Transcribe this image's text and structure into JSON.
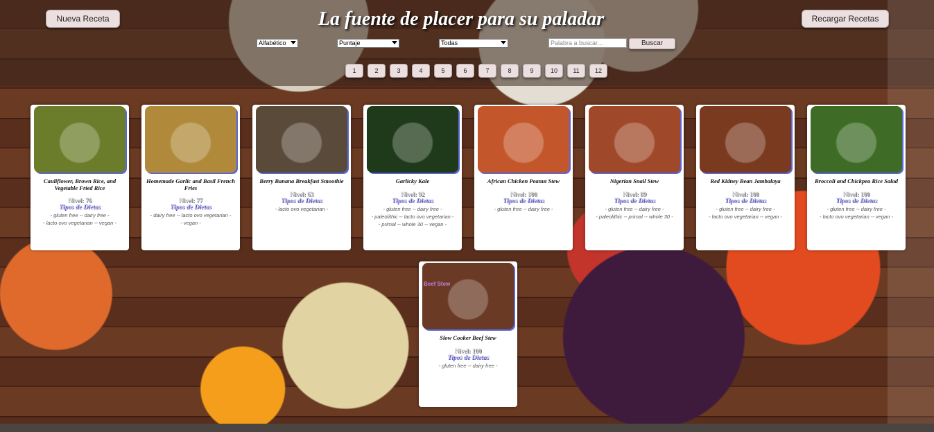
{
  "header": {
    "title": "La fuente de placer para su paladar",
    "new_recipe_label": "Nueva Receta",
    "reload_label": "Recargar Recetas"
  },
  "filters": {
    "sort_value": "Alfabético",
    "score_value": "Puntaje",
    "category_value": "Todas",
    "search_placeholder": "Palabra a buscar...",
    "search_button": "Buscar"
  },
  "pagination": [
    "1",
    "2",
    "3",
    "4",
    "5",
    "6",
    "7",
    "8",
    "9",
    "10",
    "11",
    "12"
  ],
  "recipes": [
    {
      "name": "Cauliflower, Brown Rice, and Vegetable Fried Rice",
      "nivel": "Nivel: 76",
      "tipos": "Tipos de Dietas",
      "diets": [
        "- gluten free -- dairy free -",
        "- lacto ovo vegetarian -- vegan -"
      ],
      "thumb": "#6b7d2a"
    },
    {
      "name": "Homemade Garlic and Basil French Fries",
      "nivel": "Nivel: 77",
      "tipos": "Tipos de Dietas",
      "diets": [
        "- dairy free -- lacto ovo vegetarian -",
        "- vegan -"
      ],
      "thumb": "#b08a3a"
    },
    {
      "name": "Berry Banana Breakfast Smoothie",
      "nivel": "Nivel: 63",
      "tipos": "Tipos de Dietas",
      "diets": [
        "- lacto ovo vegetarian -"
      ],
      "thumb": "#5a4a3a"
    },
    {
      "name": "Garlicky Kale",
      "nivel": "Nivel: 92",
      "tipos": "Tipos de Dietas",
      "diets": [
        "- gluten free -- dairy free -",
        "- paleolithic -- lacto ovo vegetarian -",
        "- primal -- whole 30 -- vegan -"
      ],
      "thumb": "#1f3a1a"
    },
    {
      "name": "African Chicken Peanut Stew",
      "nivel": "Nivel: 100",
      "tipos": "Tipos de Dietas",
      "diets": [
        "- gluten free -- dairy free -"
      ],
      "thumb": "#c4562b"
    },
    {
      "name": "Nigerian Snail Stew",
      "nivel": "Nivel: 89",
      "tipos": "Tipos de Dietas",
      "diets": [
        "- gluten free -- dairy free -",
        "- paleolithic -- primal -- whole 30 -"
      ],
      "thumb": "#a0492a"
    },
    {
      "name": "Red Kidney Bean Jambalaya",
      "nivel": "Nivel: 100",
      "tipos": "Tipos de Dietas",
      "diets": [
        "- gluten free -- dairy free -",
        "- lacto ovo vegetarian -- vegan -"
      ],
      "thumb": "#7a3a1f"
    },
    {
      "name": "Broccoli and Chickpea Rice Salad",
      "nivel": "Nivel: 100",
      "tipos": "Tipos de Dietas",
      "diets": [
        "- gluten free -- dairy free -",
        "- lacto ovo vegetarian -- vegan -"
      ],
      "thumb": "#3e6b25"
    },
    {
      "name": "Slow Cooker Beef Stew",
      "nivel": "Nivel: 100",
      "tipos": "Tipos de Dietas",
      "diets": [
        "- gluten free -- dairy free -"
      ],
      "thumb": "#6a3a25",
      "thumb_caption": "Beef Stew"
    }
  ]
}
